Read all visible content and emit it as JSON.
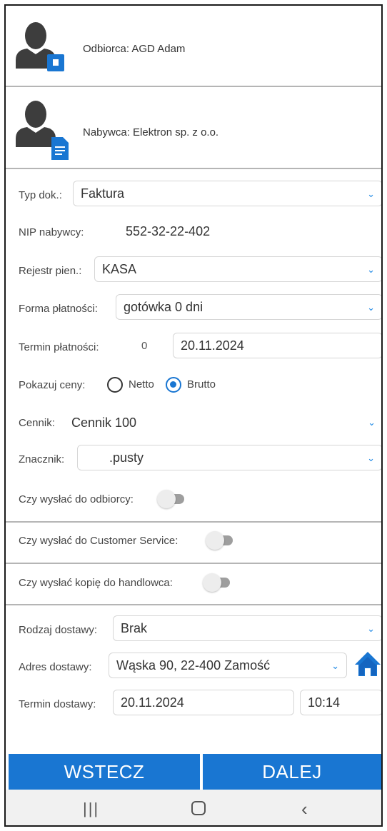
{
  "recipient": {
    "label": "Odbiorca: AGD Adam"
  },
  "buyer": {
    "label": "Nabywca: Elektron sp. z o.o."
  },
  "doc_type": {
    "label": "Typ dok.:",
    "value": "Faktura"
  },
  "nip": {
    "label": "NIP nabywcy:",
    "value": "552-32-22-402"
  },
  "register": {
    "label": "Rejestr pien.:",
    "value": "KASA"
  },
  "payment_form": {
    "label": "Forma płatności:",
    "value": "gotówka 0 dni"
  },
  "payment_term": {
    "label": "Termin płatności:",
    "days": "0",
    "date": "20.11.2024"
  },
  "show_prices": {
    "label": "Pokazuj ceny:",
    "options": [
      "Netto",
      "Brutto"
    ],
    "selected": "Brutto"
  },
  "price_list": {
    "label": "Cennik:",
    "value": "Cennik 100"
  },
  "marker": {
    "label": "Znacznik:",
    "value": ".pusty"
  },
  "toggles": {
    "send_recipient": {
      "label": "Czy wysłać do odbiorcy:",
      "on": false
    },
    "send_customer_service": {
      "label": "Czy wysłać do Customer Service:",
      "on": false
    },
    "send_copy_salesman": {
      "label": "Czy wysłać kopię do handlowca:",
      "on": false
    }
  },
  "delivery_type": {
    "label": "Rodzaj dostawy:",
    "value": "Brak"
  },
  "delivery_address": {
    "label": "Adres dostawy:",
    "value": "Wąska 90, 22-400 Zamość"
  },
  "delivery_term": {
    "label": "Termin dostawy:",
    "date": "20.11.2024",
    "time": "10:14"
  },
  "buttons": {
    "back": "WSTECZ",
    "next": "DALEJ"
  },
  "colors": {
    "accent": "#1976d2",
    "separator": "#b5b5b5"
  },
  "icons": [
    "person-icon",
    "badge-icon",
    "document-icon",
    "chevron-down-icon",
    "home-icon",
    "recent-apps-icon",
    "home-circle-icon",
    "back-icon"
  ]
}
